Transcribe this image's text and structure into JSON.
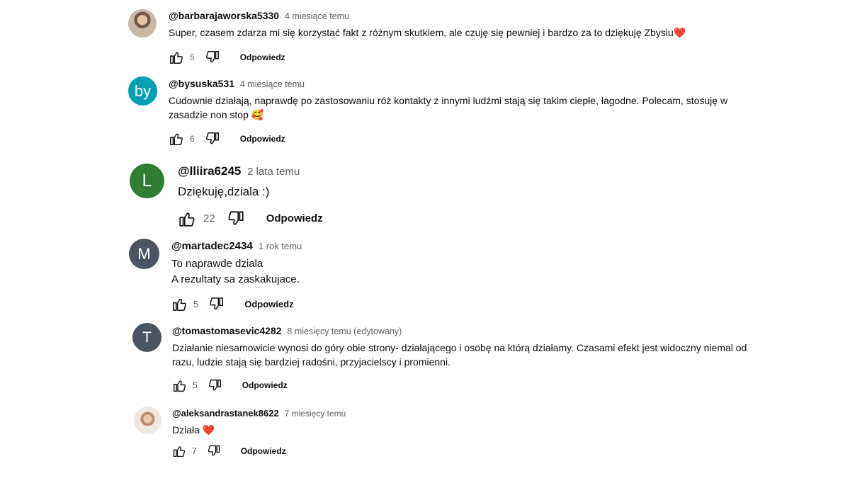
{
  "comments": [
    {
      "handle": "@barbarajaworska5330",
      "time": "4 miesiące temu",
      "text": "Super, czasem zdarza mi się korzystać fakt z różnym skutkiem, ale czuję się pewniej i bardzo za to dziękuję Zbysiu",
      "emoji": "❤️",
      "likes": "5",
      "reply_label": "Odpowiedz",
      "avatar": {
        "type": "photo",
        "letter": ""
      }
    },
    {
      "handle": "@bysuska531",
      "time": "4 miesiące temu",
      "text": "Cudownie działają, naprawdę po zastosowaniu róż kontakty z innymi ludźmi stają się takim ciepłe, łagodne. Polecam, stosuję w zasadzie non stop",
      "emoji": "🥰",
      "likes": "6",
      "reply_label": "Odpowiedz",
      "avatar": {
        "type": "letter",
        "letter": "by",
        "color": "#00a0b3"
      }
    },
    {
      "handle": "@lliira6245",
      "time": "2 lata temu",
      "text": "Dziękuję,dziala :)",
      "emoji": "",
      "likes": "22",
      "reply_label": "Odpowiedz",
      "avatar": {
        "type": "letter",
        "letter": "L",
        "color": "#2e7d32"
      }
    },
    {
      "handle": "@martadec2434",
      "time": "1 rok temu",
      "text_lines": [
        "To naprawde dziala",
        "A rezultaty sa zaskakujace."
      ],
      "likes": "5",
      "reply_label": "Odpowiedz",
      "avatar": {
        "type": "letter",
        "letter": "M",
        "color": "#4a5563"
      }
    },
    {
      "handle": "@tomastomasevic4282",
      "time": "8 miesięcy temu (edytowany)",
      "text": "Działanie niesamowicie wynosi do góry obie strony- działającego i osobę na którą działamy. Czasami efekt jest widoczny niemal od razu, ludzie stają się bardziej radośni, przyjacielscy i promienni.",
      "likes": "5",
      "reply_label": "Odpowiedz",
      "avatar": {
        "type": "letter",
        "letter": "T",
        "color": "#4a5563"
      }
    },
    {
      "handle": "@aleksandrastanek8622",
      "time": "7 miesięcy temu",
      "text": "Działa",
      "emoji": "❤️",
      "likes": "7",
      "reply_label": "Odpowiedz",
      "avatar": {
        "type": "photo",
        "letter": ""
      }
    }
  ]
}
